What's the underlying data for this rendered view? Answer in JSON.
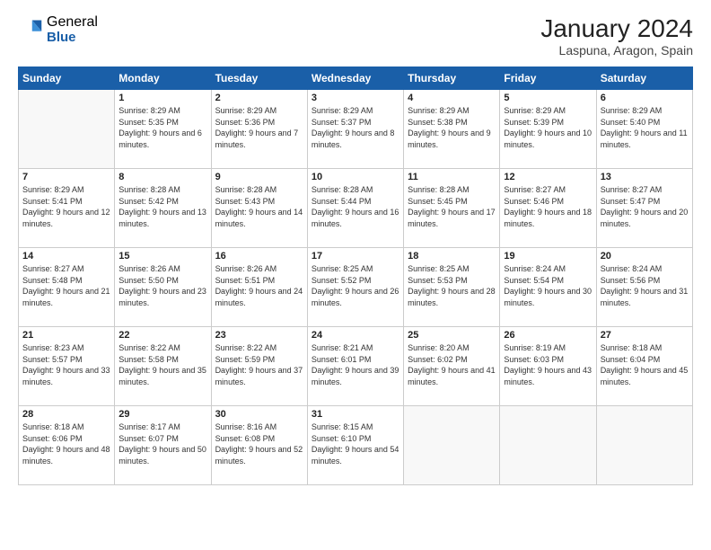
{
  "header": {
    "logo_general": "General",
    "logo_blue": "Blue",
    "month_title": "January 2024",
    "location": "Laspuna, Aragon, Spain"
  },
  "weekdays": [
    "Sunday",
    "Monday",
    "Tuesday",
    "Wednesday",
    "Thursday",
    "Friday",
    "Saturday"
  ],
  "weeks": [
    [
      {
        "day": "",
        "empty": true
      },
      {
        "day": "1",
        "sunrise": "8:29 AM",
        "sunset": "5:35 PM",
        "daylight": "9 hours and 6 minutes."
      },
      {
        "day": "2",
        "sunrise": "8:29 AM",
        "sunset": "5:36 PM",
        "daylight": "9 hours and 7 minutes."
      },
      {
        "day": "3",
        "sunrise": "8:29 AM",
        "sunset": "5:37 PM",
        "daylight": "9 hours and 8 minutes."
      },
      {
        "day": "4",
        "sunrise": "8:29 AM",
        "sunset": "5:38 PM",
        "daylight": "9 hours and 9 minutes."
      },
      {
        "day": "5",
        "sunrise": "8:29 AM",
        "sunset": "5:39 PM",
        "daylight": "9 hours and 10 minutes."
      },
      {
        "day": "6",
        "sunrise": "8:29 AM",
        "sunset": "5:40 PM",
        "daylight": "9 hours and 11 minutes."
      }
    ],
    [
      {
        "day": "7",
        "sunrise": "8:29 AM",
        "sunset": "5:41 PM",
        "daylight": "9 hours and 12 minutes."
      },
      {
        "day": "8",
        "sunrise": "8:28 AM",
        "sunset": "5:42 PM",
        "daylight": "9 hours and 13 minutes."
      },
      {
        "day": "9",
        "sunrise": "8:28 AM",
        "sunset": "5:43 PM",
        "daylight": "9 hours and 14 minutes."
      },
      {
        "day": "10",
        "sunrise": "8:28 AM",
        "sunset": "5:44 PM",
        "daylight": "9 hours and 16 minutes."
      },
      {
        "day": "11",
        "sunrise": "8:28 AM",
        "sunset": "5:45 PM",
        "daylight": "9 hours and 17 minutes."
      },
      {
        "day": "12",
        "sunrise": "8:27 AM",
        "sunset": "5:46 PM",
        "daylight": "9 hours and 18 minutes."
      },
      {
        "day": "13",
        "sunrise": "8:27 AM",
        "sunset": "5:47 PM",
        "daylight": "9 hours and 20 minutes."
      }
    ],
    [
      {
        "day": "14",
        "sunrise": "8:27 AM",
        "sunset": "5:48 PM",
        "daylight": "9 hours and 21 minutes."
      },
      {
        "day": "15",
        "sunrise": "8:26 AM",
        "sunset": "5:50 PM",
        "daylight": "9 hours and 23 minutes."
      },
      {
        "day": "16",
        "sunrise": "8:26 AM",
        "sunset": "5:51 PM",
        "daylight": "9 hours and 24 minutes."
      },
      {
        "day": "17",
        "sunrise": "8:25 AM",
        "sunset": "5:52 PM",
        "daylight": "9 hours and 26 minutes."
      },
      {
        "day": "18",
        "sunrise": "8:25 AM",
        "sunset": "5:53 PM",
        "daylight": "9 hours and 28 minutes."
      },
      {
        "day": "19",
        "sunrise": "8:24 AM",
        "sunset": "5:54 PM",
        "daylight": "9 hours and 30 minutes."
      },
      {
        "day": "20",
        "sunrise": "8:24 AM",
        "sunset": "5:56 PM",
        "daylight": "9 hours and 31 minutes."
      }
    ],
    [
      {
        "day": "21",
        "sunrise": "8:23 AM",
        "sunset": "5:57 PM",
        "daylight": "9 hours and 33 minutes."
      },
      {
        "day": "22",
        "sunrise": "8:22 AM",
        "sunset": "5:58 PM",
        "daylight": "9 hours and 35 minutes."
      },
      {
        "day": "23",
        "sunrise": "8:22 AM",
        "sunset": "5:59 PM",
        "daylight": "9 hours and 37 minutes."
      },
      {
        "day": "24",
        "sunrise": "8:21 AM",
        "sunset": "6:01 PM",
        "daylight": "9 hours and 39 minutes."
      },
      {
        "day": "25",
        "sunrise": "8:20 AM",
        "sunset": "6:02 PM",
        "daylight": "9 hours and 41 minutes."
      },
      {
        "day": "26",
        "sunrise": "8:19 AM",
        "sunset": "6:03 PM",
        "daylight": "9 hours and 43 minutes."
      },
      {
        "day": "27",
        "sunrise": "8:18 AM",
        "sunset": "6:04 PM",
        "daylight": "9 hours and 45 minutes."
      }
    ],
    [
      {
        "day": "28",
        "sunrise": "8:18 AM",
        "sunset": "6:06 PM",
        "daylight": "9 hours and 48 minutes."
      },
      {
        "day": "29",
        "sunrise": "8:17 AM",
        "sunset": "6:07 PM",
        "daylight": "9 hours and 50 minutes."
      },
      {
        "day": "30",
        "sunrise": "8:16 AM",
        "sunset": "6:08 PM",
        "daylight": "9 hours and 52 minutes."
      },
      {
        "day": "31",
        "sunrise": "8:15 AM",
        "sunset": "6:10 PM",
        "daylight": "9 hours and 54 minutes."
      },
      {
        "day": "",
        "empty": true
      },
      {
        "day": "",
        "empty": true
      },
      {
        "day": "",
        "empty": true
      }
    ]
  ]
}
